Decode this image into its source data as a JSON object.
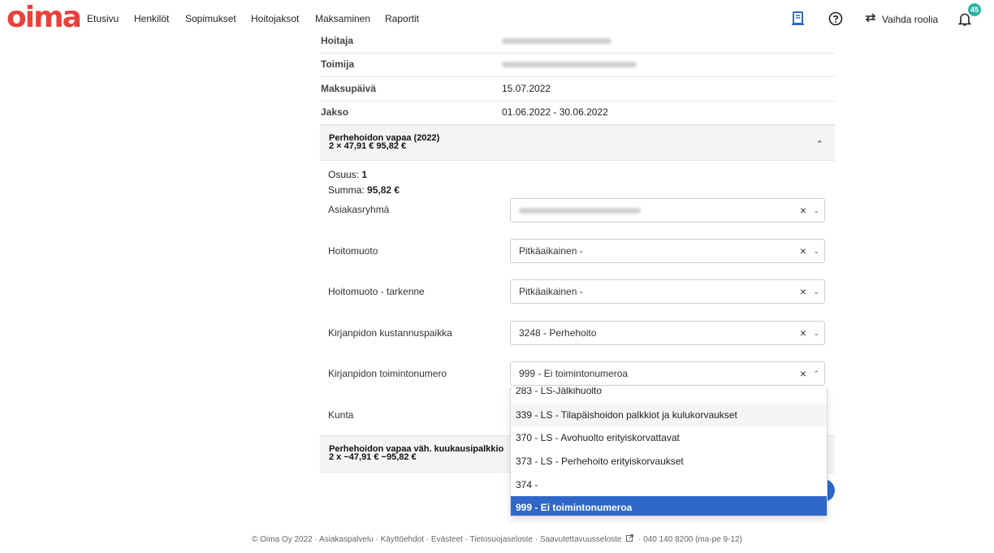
{
  "brand": {
    "logo_text": "oima",
    "logo_color": "#e8413c"
  },
  "nav": {
    "items": [
      "Etusivu",
      "Henkilöt",
      "Sopimukset",
      "Hoitojaksot",
      "Maksaminen",
      "Raportit"
    ],
    "switch_role_label": "Vaihda roolia",
    "notification_count": "45"
  },
  "details": {
    "rows": [
      {
        "label": "Hoitaja",
        "value": ""
      },
      {
        "label": "Toimija",
        "value": ""
      },
      {
        "label": "Maksupäivä",
        "value": "15.07.2022"
      },
      {
        "label": "Jakso",
        "value": "01.06.2022 - 30.06.2022"
      }
    ]
  },
  "section1": {
    "title": "Perhehoidon vapaa (2022)",
    "subtitle": "2 × 47,91 € 95,82 €",
    "share_label": "Osuus:",
    "share_value": "1",
    "sum_label": "Summa:",
    "sum_value": "95,82 €",
    "fields": [
      {
        "label": "Asiakasryhmä",
        "value": ""
      },
      {
        "label": "Hoitomuoto",
        "value": "Pitkäaikainen -"
      },
      {
        "label": "Hoitomuoto - tarkenne",
        "value": "Pitkäaikainen -"
      },
      {
        "label": "Kirjanpidon kustannuspaikka",
        "value": "3248 - Perhehoito"
      },
      {
        "label": "Kirjanpidon toimintonumero",
        "value": "999 - Ei toimintonumeroa"
      },
      {
        "label": "Kunta",
        "value": ""
      }
    ],
    "clear_symbol": "×"
  },
  "dropdown": {
    "options": [
      "283 - LS-Jälkihuolto",
      "339 - LS - Tilapäishoidon palkkiot ja kulukorvaukset",
      "370 - LS - Avohuolto erityiskorvattavat",
      "373 - LS - Perhehoito erityiskorvaukset",
      "374 -",
      "999 - Ei toimintonumeroa"
    ],
    "selected_index": 5,
    "selected_color": "#2f68c8"
  },
  "section2": {
    "title": "Perhehoidon vapaa väh. kuukausipalkkio",
    "subtitle": "2 x −47,91 € −95,82 €"
  },
  "footer": {
    "text_before": "© Oima Oy 2022 · Asiakaspalvelu · Käyttöehdot · Evästeet · Tietosuojaseloste · Saavutettavuusseloste",
    "text_after": "· 040 140 8200 (ma-pe 9-12)"
  }
}
